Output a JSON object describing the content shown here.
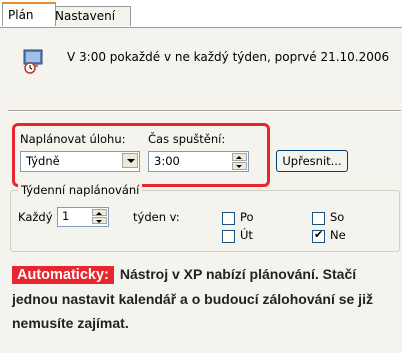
{
  "tabs": {
    "plan": "Plán",
    "settings": "Nastavení"
  },
  "schedule": {
    "summary": "V 3:00 pokaždé v ne každý týden, poprvé 21.10.2006",
    "icon": "scheduled-task-icon"
  },
  "task_schedule": {
    "label": "Naplánovat úlohu:",
    "value": "Týdně",
    "icon": "chevron-down-icon"
  },
  "start_time": {
    "label": "Čas spuštění:",
    "value": "3:00"
  },
  "advanced_button": {
    "label": "Upřesnit..."
  },
  "weekly": {
    "title": "Týdenní naplánování",
    "every_label": "Každý",
    "every_value": "1",
    "weeks_on_label": "týden v:",
    "days": [
      {
        "label": "Po",
        "checked": false
      },
      {
        "label": "So",
        "checked": false
      },
      {
        "label": "Út",
        "checked": false
      },
      {
        "label": "Ne",
        "checked": true
      }
    ],
    "check_mark": "✔"
  },
  "caption": {
    "tag": "Automaticky:",
    "text": "Nástroj v XP nabízí plánování. Stačí jednou nastavit kalendář a o budoucí zálohování se již nemusíte zajímat."
  },
  "colors": {
    "accent_red": "#e8262f",
    "tab_highlight": "#e68b2c",
    "panel_bg": "#f4f3ee"
  }
}
